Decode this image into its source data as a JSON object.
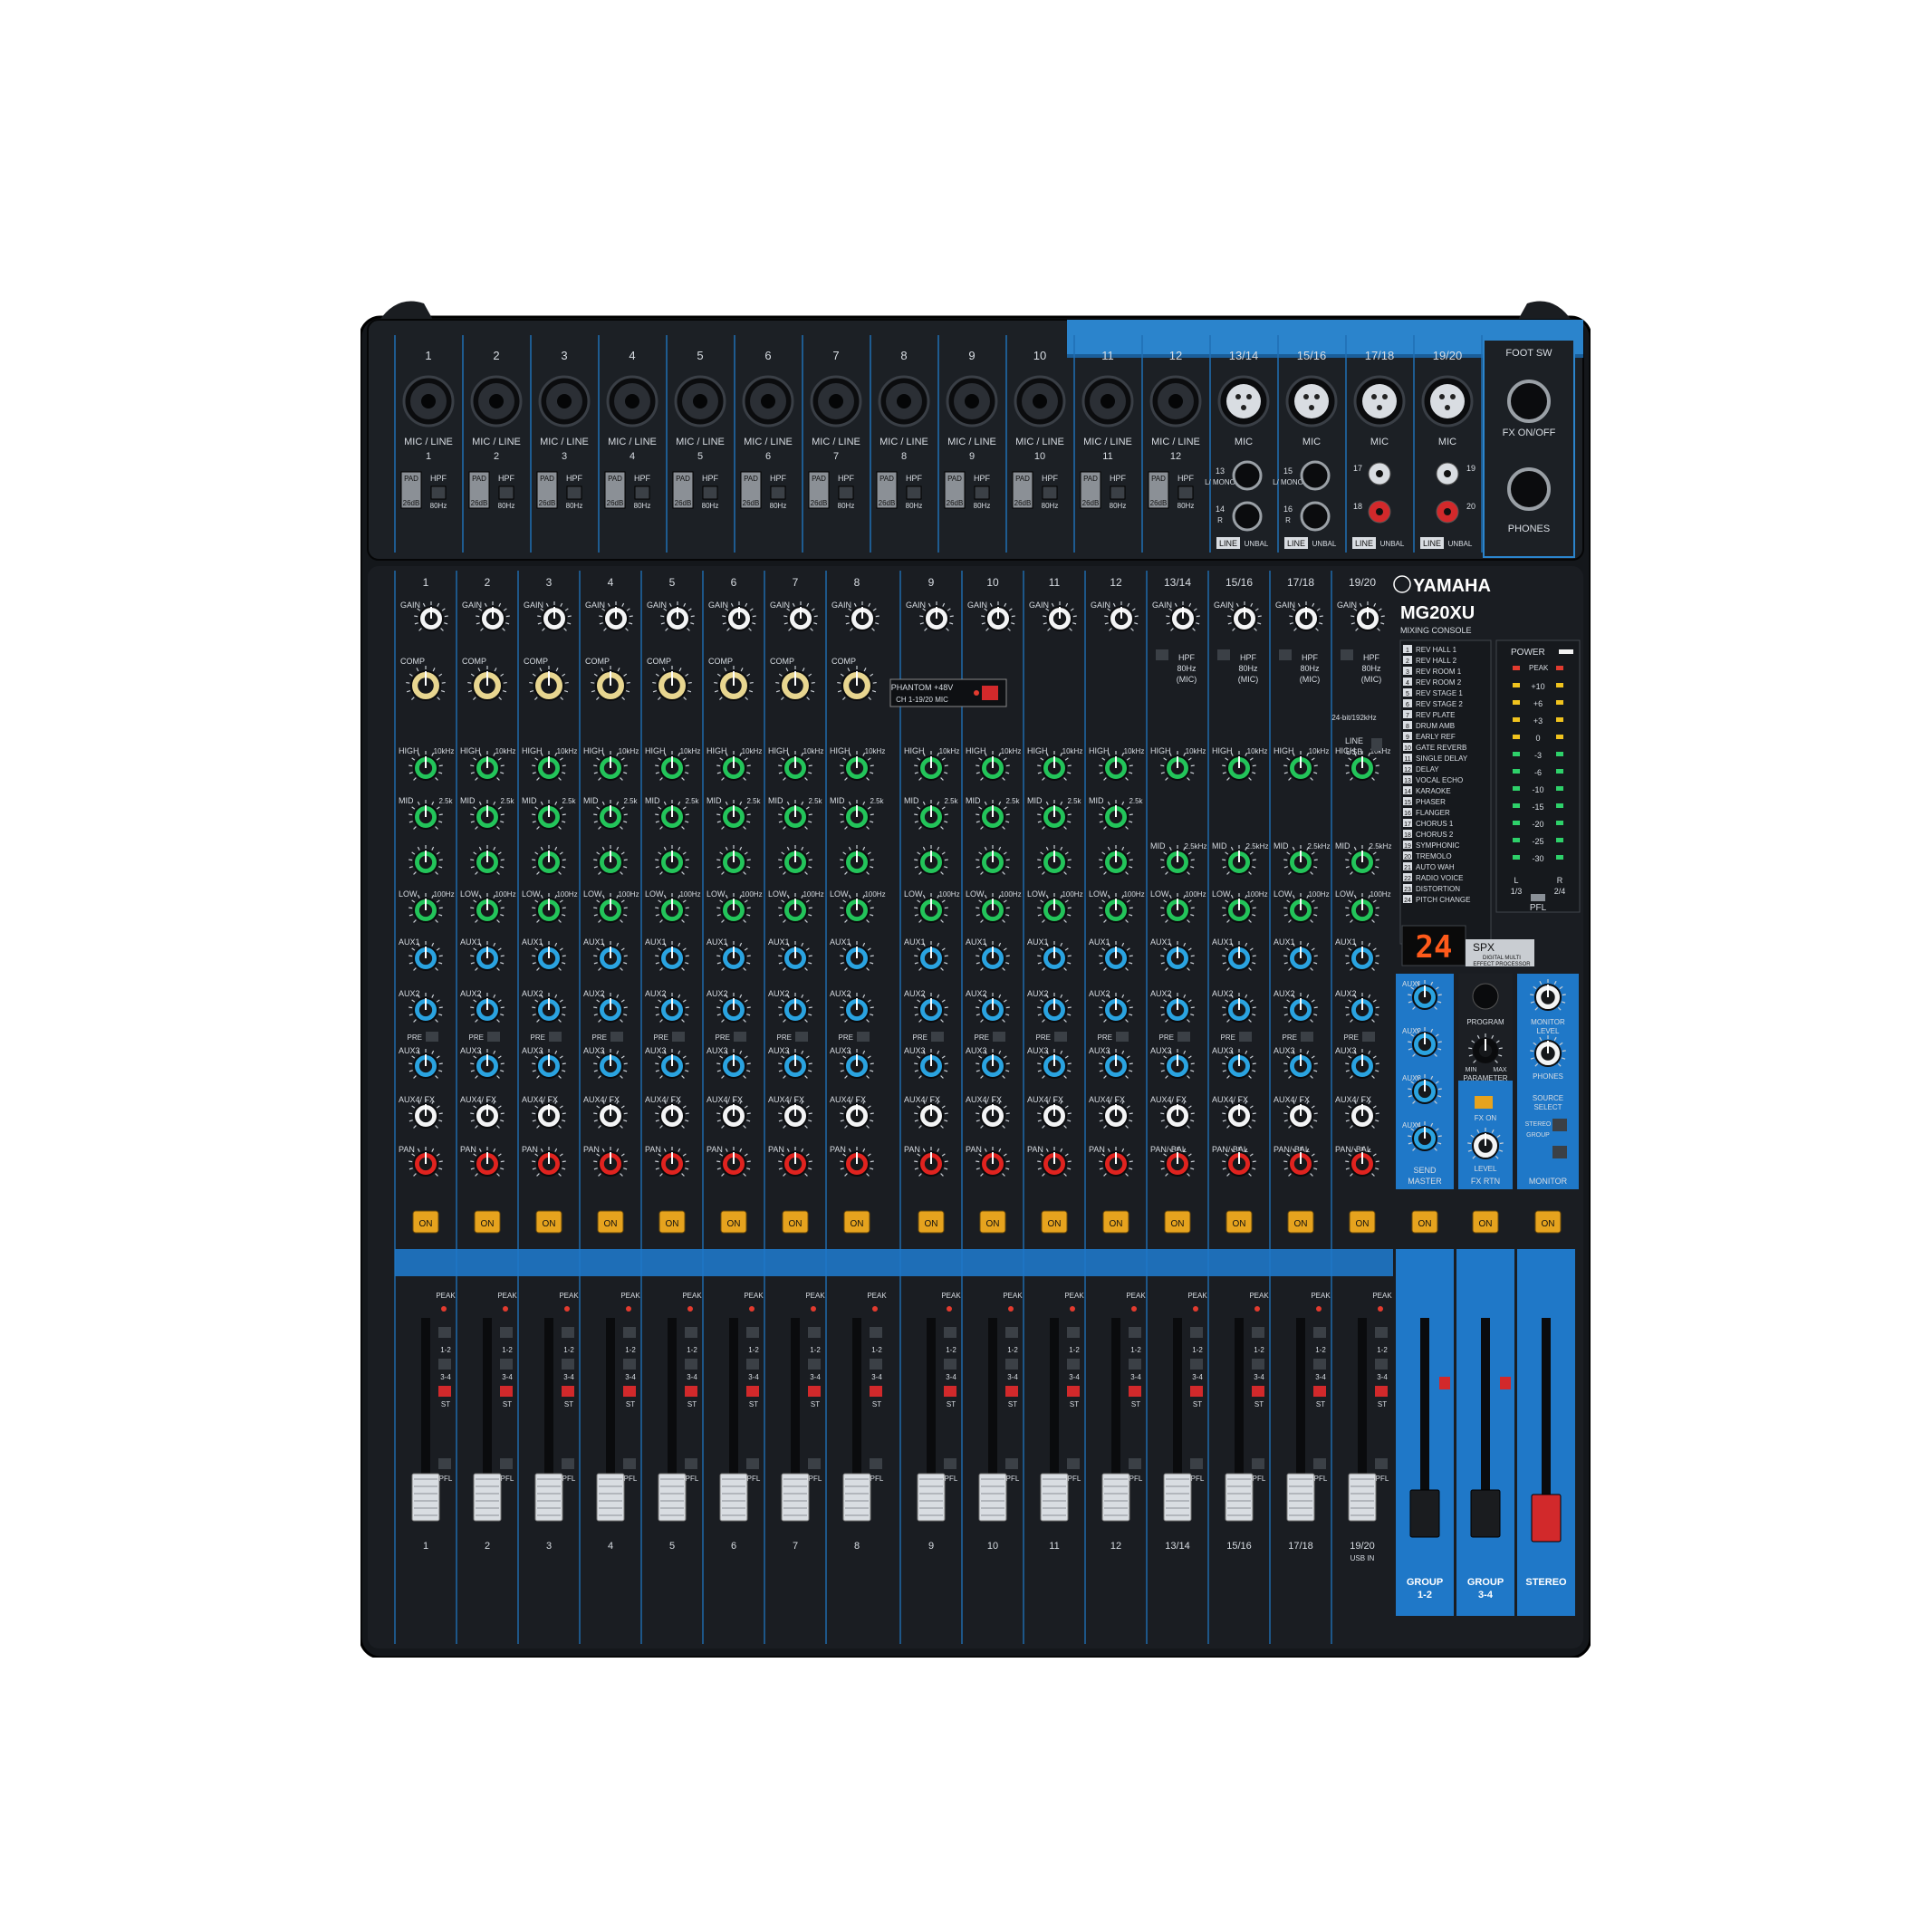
{
  "brand": {
    "logo_text": "YAMAHA",
    "model": "MG20XU",
    "subtitle": "MIXING CONSOLE"
  },
  "input_channels": [
    {
      "top": "1",
      "jack_label": "MIC / LINE",
      "jack_num": "1",
      "strip": "1",
      "bottom": "1",
      "type": "mono"
    },
    {
      "top": "2",
      "jack_label": "MIC / LINE",
      "jack_num": "2",
      "strip": "2",
      "bottom": "2",
      "type": "mono"
    },
    {
      "top": "3",
      "jack_label": "MIC / LINE",
      "jack_num": "3",
      "strip": "3",
      "bottom": "3",
      "type": "mono"
    },
    {
      "top": "4",
      "jack_label": "MIC / LINE",
      "jack_num": "4",
      "strip": "4",
      "bottom": "4",
      "type": "mono"
    },
    {
      "top": "5",
      "jack_label": "MIC / LINE",
      "jack_num": "5",
      "strip": "5",
      "bottom": "5",
      "type": "mono"
    },
    {
      "top": "6",
      "jack_label": "MIC / LINE",
      "jack_num": "6",
      "strip": "6",
      "bottom": "6",
      "type": "mono"
    },
    {
      "top": "7",
      "jack_label": "MIC / LINE",
      "jack_num": "7",
      "strip": "7",
      "bottom": "7",
      "type": "mono"
    },
    {
      "top": "8",
      "jack_label": "MIC / LINE",
      "jack_num": "8",
      "strip": "8",
      "bottom": "8",
      "type": "mono"
    },
    {
      "top": "9",
      "jack_label": "MIC / LINE",
      "jack_num": "9",
      "strip": "9",
      "bottom": "9",
      "type": "mono-nocomp"
    },
    {
      "top": "10",
      "jack_label": "MIC / LINE",
      "jack_num": "10",
      "strip": "10",
      "bottom": "10",
      "type": "mono-nocomp"
    },
    {
      "top": "11",
      "jack_label": "MIC / LINE",
      "jack_num": "11",
      "strip": "11",
      "bottom": "11",
      "type": "mono-nocomp"
    },
    {
      "top": "12",
      "jack_label": "MIC / LINE",
      "jack_num": "12",
      "strip": "12",
      "bottom": "12",
      "type": "mono-nocomp"
    },
    {
      "top": "13/14",
      "jack_label": "MIC",
      "strip": "13/14",
      "bottom": "13/14",
      "type": "stereo"
    },
    {
      "top": "15/16",
      "jack_label": "MIC",
      "strip": "15/16",
      "bottom": "15/16",
      "type": "stereo"
    },
    {
      "top": "17/18",
      "jack_label": "MIC",
      "strip": "17/18",
      "bottom": "17/18",
      "type": "stereo"
    },
    {
      "top": "19/20",
      "jack_label": "MIC",
      "strip": "19/20",
      "bottom": "19/20",
      "extra": "USB IN",
      "type": "stereo"
    }
  ],
  "jack_panel": {
    "pad": "PAD",
    "pad_value": "26dB",
    "hpf": "HPF",
    "hpf_value": "80Hz",
    "line_mono": [
      {
        "top": "13",
        "bottom": "14",
        "l": "L/ MONO",
        "r": "R"
      },
      {
        "top": "15",
        "bottom": "16",
        "l": "L/ MONO",
        "r": "R"
      }
    ],
    "rca": [
      {
        "l": "17",
        "r": "19",
        "l2": "18",
        "r2": "20"
      }
    ],
    "line_label": "LINE",
    "unbal_label": "UNBAL",
    "foot_sw": "FOOT SW",
    "fx_onoff": "FX ON/OFF",
    "phones": "PHONES"
  },
  "controls": {
    "gain": "GAIN",
    "comp": "COMP",
    "high": "HIGH",
    "high_freq": "10kHz",
    "mid": "MID",
    "mid_freq": "2.5k",
    "mid_fixed": "2.5kHz",
    "low": "LOW",
    "low_freq": "100Hz",
    "aux1": "AUX1",
    "pre": "PRE",
    "aux2": "AUX2",
    "aux3": "AUX3",
    "aux4fx": "AUX4/ FX",
    "pan": "PAN",
    "panbal": "PAN/ BAL",
    "hpf_mic": "HPF 80Hz (MIC)",
    "line_usb": "LINE USB",
    "on": "ON",
    "peak": "PEAK",
    "pfl": "PFL",
    "st": "ST",
    "g12": "1-2",
    "g34": "3-4",
    "phantom": "PHANTOM +48V",
    "phantom_sub": "CH 1-19/20 MIC",
    "usb_spec": "24-bit/192kHz"
  },
  "fx_programs": [
    "REV HALL 1",
    "REV HALL 2",
    "REV ROOM 1",
    "REV ROOM 2",
    "REV STAGE 1",
    "REV STAGE 2",
    "REV PLATE",
    "DRUM AMB",
    "EARLY REF",
    "GATE REVERB",
    "SINGLE DELAY",
    "DELAY",
    "VOCAL ECHO",
    "KARAOKE",
    "PHASER",
    "FLANGER",
    "CHORUS 1",
    "CHORUS 2",
    "SYMPHONIC",
    "TREMOLO",
    "AUTO WAH",
    "RADIO VOICE",
    "DISTORTION",
    "PITCH CHANGE"
  ],
  "fx_display": "24",
  "spx": {
    "logo": "SPX",
    "caption1": "DIGITAL MULTI",
    "caption2": "EFFECT PROCESSOR"
  },
  "meter": {
    "power": "POWER",
    "peak": "PEAK",
    "scale": [
      "+10",
      "+6",
      "+3",
      "0",
      "-3",
      "-6",
      "-10",
      "-15",
      "-20",
      "-25",
      "-30"
    ],
    "l": "L",
    "r": "R",
    "l_sub": "1/3",
    "r_sub": "2/4",
    "pfl": "PFL"
  },
  "master": {
    "aux1": "AUX1",
    "aux2": "AUX2",
    "aux3": "AUX3",
    "aux4": "AUX4",
    "send_master": "SEND MASTER",
    "program": "PROGRAM",
    "parameter": "PARAMETER",
    "min": "MIN",
    "max": "MAX",
    "fx_on": "FX ON",
    "level": "LEVEL",
    "fx_rtn": "FX RTN",
    "monitor_level": "MONITOR LEVEL",
    "phones": "PHONES",
    "source_select": "SOURCE SELECT",
    "stereo": "STEREO",
    "group": "GROUP",
    "monitor": "MONITOR",
    "group12": "GROUP 1-2",
    "group34": "GROUP 3-4",
    "stereo_out": "STEREO"
  },
  "colors": {
    "panel": "#1c1f24",
    "accent_blue": "#1f78c8",
    "eq_green": "#23c45a",
    "aux_blue": "#2aa3e0",
    "pan_red": "#e0231f",
    "comp_cream": "#e8d690",
    "on_amber": "#e6a31e"
  }
}
